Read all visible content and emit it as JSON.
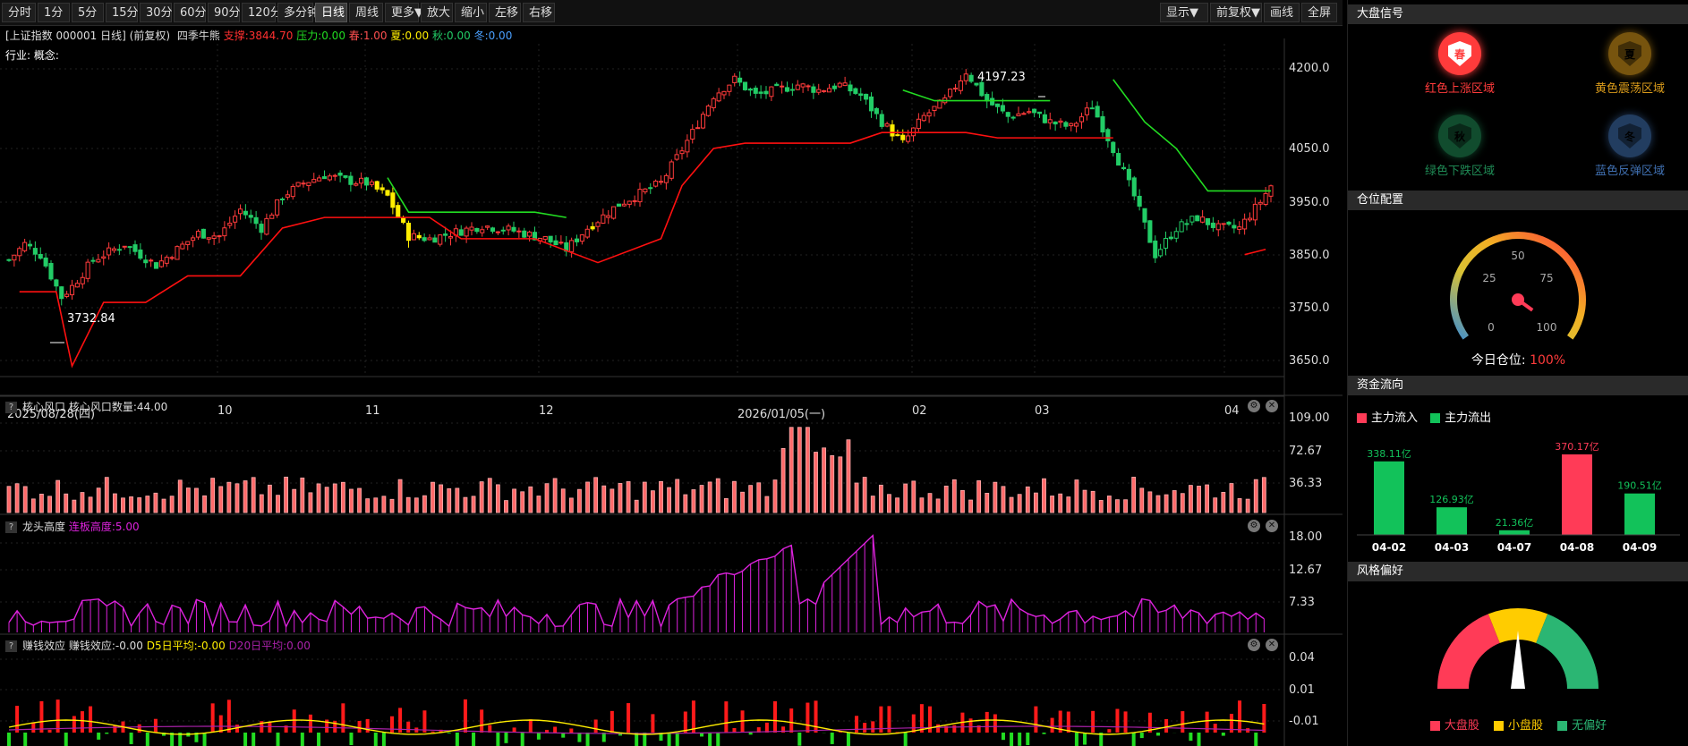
{
  "toolbar": {
    "left": [
      "分时",
      "1分",
      "5分",
      "15分",
      "30分",
      "60分",
      "90分",
      "120分",
      "多分钟",
      "日线",
      "周线",
      "更多▼",
      "放大",
      "缩小",
      "左移",
      "右移"
    ],
    "active": "日线",
    "right": [
      "显示▼",
      "前复权▼",
      "画线",
      "全屏"
    ]
  },
  "chart": {
    "title": "[上证指数 000001 日线]",
    "adjust": "(前复权)",
    "indicator": "四季牛熊",
    "support": "支撑:3844.70",
    "pressure": "压力:0.00",
    "spring": "春:1.00",
    "summer": "夏:0.00",
    "autumn": "秋:0.00",
    "winter": "冬:0.00",
    "industry": "行业: 概念:",
    "high_label": "4197.23",
    "low_label": "3732.84",
    "yaxis": [
      "4200.0",
      "4050.0",
      "3950.0",
      "3850.0",
      "3750.0",
      "3650.0"
    ],
    "dates": [
      "2025/08/28(四)",
      "10",
      "11",
      "12",
      "2026/01/05(一)",
      "02",
      "03",
      "04"
    ]
  },
  "panel1": {
    "title": "核心风口",
    "value": "核心风口数量:44.00",
    "yaxis": [
      "109.00",
      "72.67",
      "36.33"
    ]
  },
  "panel2": {
    "title": "龙头高度",
    "value": "连板高度:5.00",
    "yaxis": [
      "18.00",
      "12.67",
      "7.33"
    ]
  },
  "panel3": {
    "title": "赚钱效应",
    "value": "赚钱效应:-0.00",
    "ma5": "D5日平均:-0.00",
    "ma20": "D20日平均:0.00",
    "yaxis": [
      "0.04",
      "0.01",
      "-0.01"
    ]
  },
  "colors": {
    "up": "#ff3b3b",
    "down": "#22cc66",
    "yellow": "#ffee00",
    "magenta": "#dd22dd",
    "support": "#ff1010",
    "pressure": "#22dd22"
  },
  "right": {
    "signal_title": "大盘信号",
    "seasons": [
      {
        "char": "春",
        "label": "红色上涨区域",
        "color": "#ff3b3b"
      },
      {
        "char": "夏",
        "label": "黄色震荡区域",
        "color": "#d99a1a"
      },
      {
        "char": "秋",
        "label": "绿色下跌区域",
        "color": "#1f8a55"
      },
      {
        "char": "冬",
        "label": "蓝色反弹区域",
        "color": "#3f6fb0"
      }
    ],
    "position_title": "仓位配置",
    "gauge_ticks": [
      "0",
      "25",
      "50",
      "75",
      "100"
    ],
    "position_label": "今日仓位:",
    "position_value": "100%",
    "position_level": 1.0,
    "flow_title": "资金流向",
    "flow_in": "主力流入",
    "flow_out": "主力流出",
    "flow": [
      {
        "date": "04-02",
        "value": 338.11,
        "label": "338.11亿",
        "type": "out"
      },
      {
        "date": "04-03",
        "value": 126.93,
        "label": "126.93亿",
        "type": "out"
      },
      {
        "date": "04-07",
        "value": 21.36,
        "label": "21.36亿",
        "type": "out"
      },
      {
        "date": "04-08",
        "value": 370.17,
        "label": "370.17亿",
        "type": "in"
      },
      {
        "date": "04-09",
        "value": 190.51,
        "label": "190.51亿",
        "type": "out"
      }
    ],
    "style_title": "风格偏好",
    "style_legend": [
      "大盘股",
      "小盘股",
      "无偏好"
    ]
  }
}
